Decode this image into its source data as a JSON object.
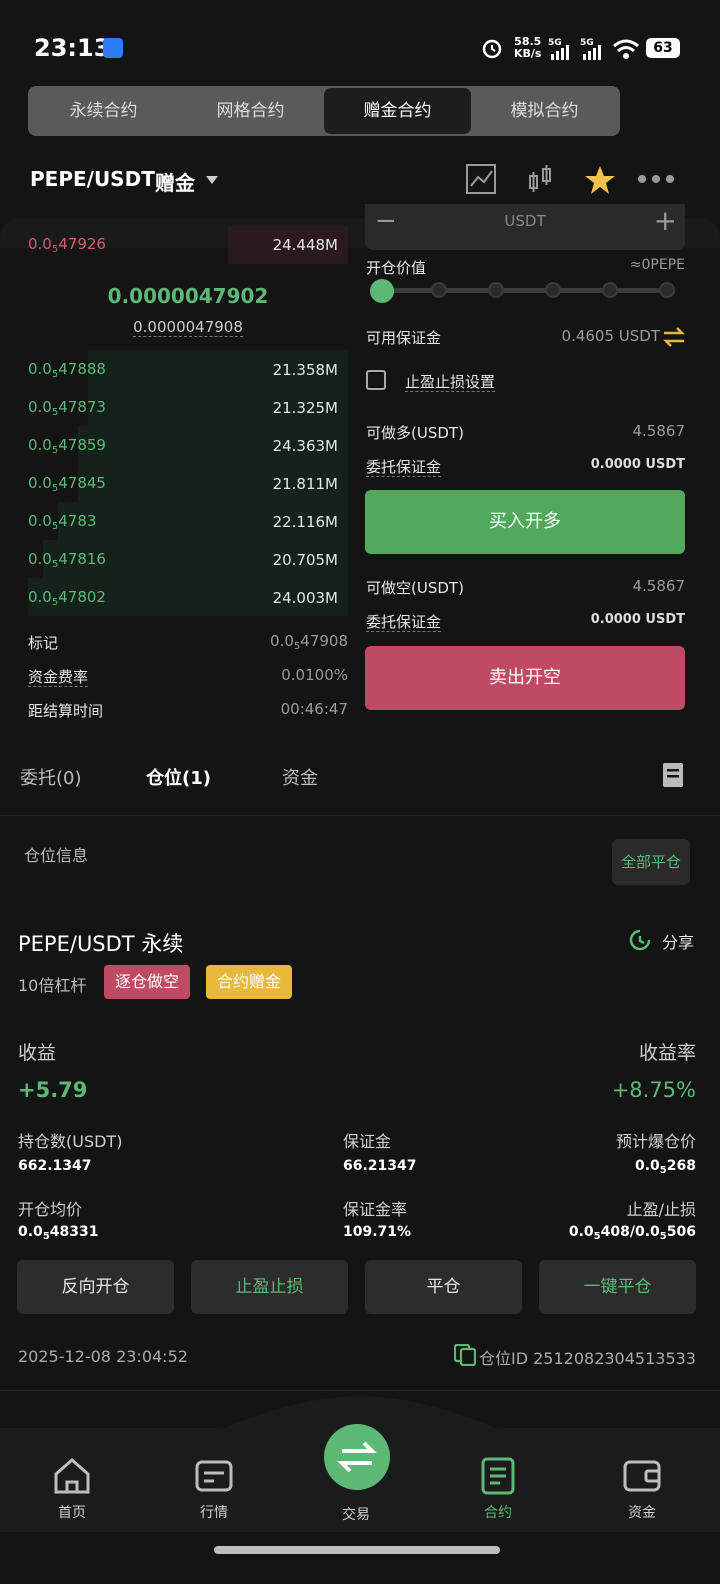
{
  "status": {
    "time": "23:13",
    "net_speed": "58.5",
    "net_unit": "KB/s",
    "sig1": "5G",
    "sig2": "5G",
    "battery": "63"
  },
  "segments": [
    "永续合约",
    "网格合约",
    "赠金合约",
    "模拟合约"
  ],
  "header": {
    "pair": "PEPE/USDT",
    "tag": "赠金"
  },
  "orderbook": {
    "ask": {
      "price_pre": "0.0",
      "price_sub": "5",
      "price_post": "47926",
      "amount": "24.448M"
    },
    "mid_price": "0.0000047902",
    "mark_price": "0.0000047908",
    "bids": [
      {
        "pre": "0.0",
        "sub": "5",
        "post": "47888",
        "amount": "21.358M"
      },
      {
        "pre": "0.0",
        "sub": "5",
        "post": "47873",
        "amount": "21.325M"
      },
      {
        "pre": "0.0",
        "sub": "5",
        "post": "47859",
        "amount": "24.363M"
      },
      {
        "pre": "0.0",
        "sub": "5",
        "post": "47845",
        "amount": "21.811M"
      },
      {
        "pre": "0.0",
        "sub": "5",
        "post": "4783",
        "amount": "22.116M"
      },
      {
        "pre": "0.0",
        "sub": "5",
        "post": "47816",
        "amount": "20.705M"
      },
      {
        "pre": "0.0",
        "sub": "5",
        "post": "47802",
        "amount": "24.003M"
      }
    ],
    "mark_label": "标记",
    "mark_pre": "0.0",
    "mark_sub": "5",
    "mark_post": "47908",
    "funding_label": "资金费率",
    "funding_value": "0.0100%",
    "settle_label": "距结算时间",
    "settle_value": "00:46:47"
  },
  "panel": {
    "unit": "USDT",
    "open_value_label": "开仓价值",
    "open_value": "≈0PEPE",
    "available_label": "可用保证金",
    "available_value": "0.4605 USDT",
    "tpsl_label": "止盈止损设置",
    "long_label": "可做多(USDT)",
    "long_value": "4.5867",
    "margin_label": "委托保证金",
    "margin_value": "0.0000 USDT",
    "buy_btn": "买入开多",
    "short_label": "可做空(USDT)",
    "short_value": "4.5867",
    "margin_label2": "委托保证金",
    "margin_value2": "0.0000 USDT",
    "sell_btn": "卖出开空"
  },
  "tabs": {
    "orders": "委托(0)",
    "positions": "仓位(1)",
    "funds": "资金"
  },
  "position": {
    "section_title": "仓位信息",
    "close_all": "全部平仓",
    "title": "PEPE/USDT 永续",
    "share": "分享",
    "leverage": "10倍杠杆",
    "tag_short": "逐仓做空",
    "tag_bonus": "合约赠金",
    "pnl_label": "收益",
    "pnl_value": "+5.79",
    "roe_label": "收益率",
    "roe_value": "+8.75%",
    "qty_label": "持仓数(USDT)",
    "qty_value": "662.1347",
    "margin_label": "保证金",
    "margin_value": "66.21347",
    "liq_label": "预计爆仓价",
    "liq_pre": "0.0",
    "liq_sub": "5",
    "liq_post": "268",
    "entry_label": "开仓均价",
    "entry_pre": "0.0",
    "entry_sub": "5",
    "entry_post": "48331",
    "ratio_label": "保证金率",
    "ratio_value": "109.71%",
    "tpsl_label": "止盈/止损",
    "tp_pre": "0.0",
    "tp_sub": "5",
    "tp_post": "408/",
    "sl_pre": "0.0",
    "sl_sub": "5",
    "sl_post": "506",
    "btn_reverse": "反向开仓",
    "btn_tpsl": "止盈止损",
    "btn_close": "平仓",
    "btn_quick_close": "一键平仓",
    "time": "2025-12-08 23:04:52",
    "id_label": "仓位ID 2512082304513533"
  },
  "nav": [
    "首页",
    "行情",
    "交易",
    "合约",
    "资金"
  ],
  "colors": {
    "green": "#5bb975",
    "red": "#d45a6e",
    "buy": "#52a95c",
    "sell": "#c04a64",
    "yellow": "#e7b93a"
  }
}
